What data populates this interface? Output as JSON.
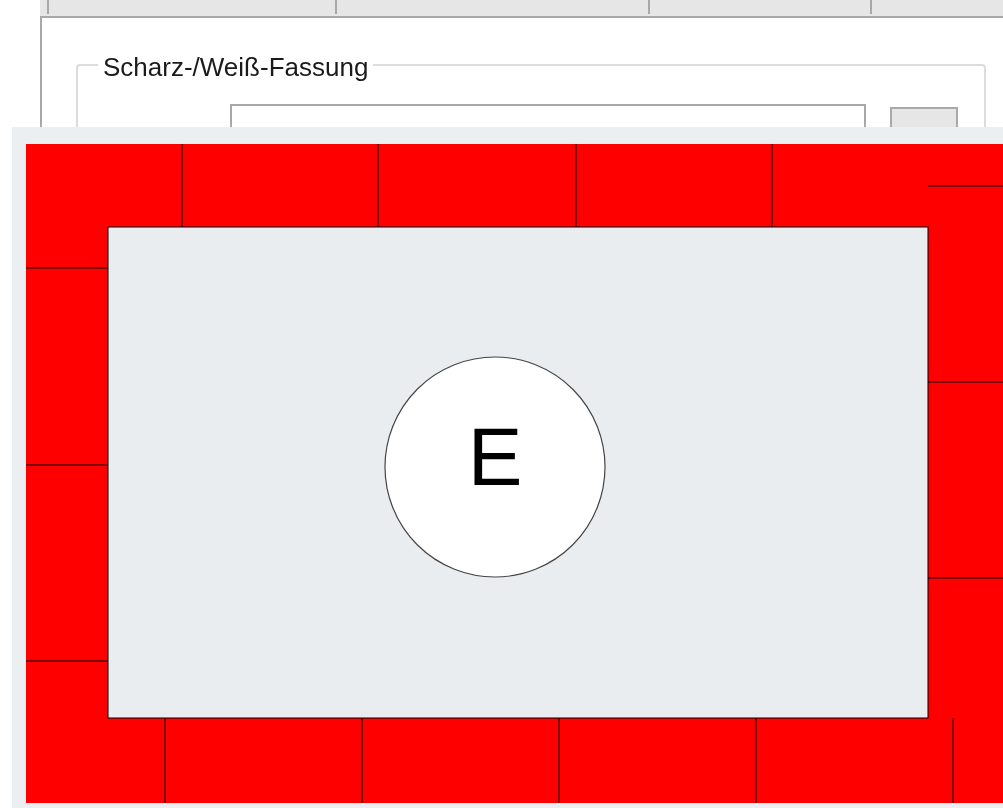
{
  "dialog": {
    "group_title": "Scharz-/Weiß-Fassung"
  },
  "frame_preview": {
    "center_label": "E"
  }
}
